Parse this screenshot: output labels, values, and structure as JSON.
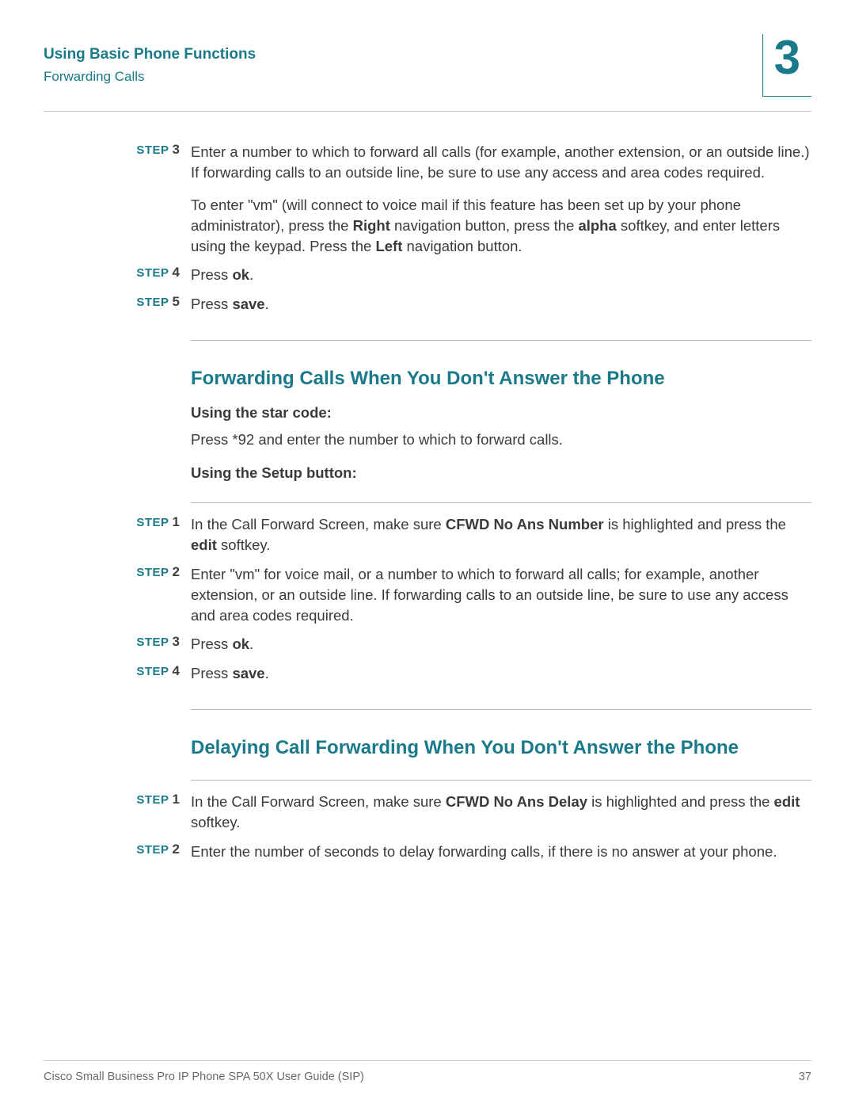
{
  "header": {
    "chapter_title": "Using Basic Phone Functions",
    "subsection": "Forwarding Calls",
    "chapter_number": "3"
  },
  "topsteps": {
    "step3": {
      "label": "STEP",
      "num": "3",
      "text": "Enter a number to which to forward all calls (for example, another extension, or an outside line.) If forwarding calls to an outside line, be sure to use any access and area codes required."
    },
    "vm_para_pre": "To enter \"vm\" (will connect to voice mail if this feature has been set up by your phone administrator), press the ",
    "vm_b1": "Right",
    "vm_mid1": " navigation button, press the ",
    "vm_b2": "alpha",
    "vm_mid2": " softkey, and enter letters using the keypad. Press the ",
    "vm_b3": "Left",
    "vm_end": " navigation button.",
    "step4": {
      "label": "STEP",
      "num": "4",
      "pre": "Press ",
      "bold": "ok",
      "post": "."
    },
    "step5": {
      "label": "STEP",
      "num": "5",
      "pre": "Press ",
      "bold": "save",
      "post": "."
    }
  },
  "sectionA": {
    "heading": "Forwarding Calls When You Don't Answer the Phone",
    "starcode_label": "Using the star code:",
    "starcode_text": "Press *92 and enter the number to which to forward calls.",
    "setup_label": "Using the Setup button:",
    "step1": {
      "label": "STEP",
      "num": "1",
      "pre": "In the Call Forward Screen, make sure ",
      "b1": "CFWD No Ans Number",
      "mid": " is highlighted and press the ",
      "b2": "edit",
      "post": " softkey."
    },
    "step2": {
      "label": "STEP",
      "num": "2",
      "text": "Enter \"vm\" for voice mail, or a number to which to forward all calls; for example, another extension, or an outside line. If forwarding calls to an outside line, be sure to use any access and area codes required."
    },
    "step3": {
      "label": "STEP",
      "num": "3",
      "pre": "Press ",
      "bold": "ok",
      "post": "."
    },
    "step4": {
      "label": "STEP",
      "num": "4",
      "pre": "Press ",
      "bold": "save",
      "post": "."
    }
  },
  "sectionB": {
    "heading": "Delaying Call Forwarding When You Don't Answer the Phone",
    "step1": {
      "label": "STEP",
      "num": "1",
      "pre": "In the Call Forward Screen, make sure ",
      "b1": "CFWD No Ans Delay",
      "mid": " is highlighted and press the ",
      "b2": "edit",
      "post": " softkey."
    },
    "step2": {
      "label": "STEP",
      "num": "2",
      "text": "Enter the number of seconds to delay forwarding calls, if there is no answer at your phone."
    }
  },
  "footer": {
    "left": "Cisco Small Business Pro IP Phone SPA 50X User Guide (SIP)",
    "right": "37"
  }
}
